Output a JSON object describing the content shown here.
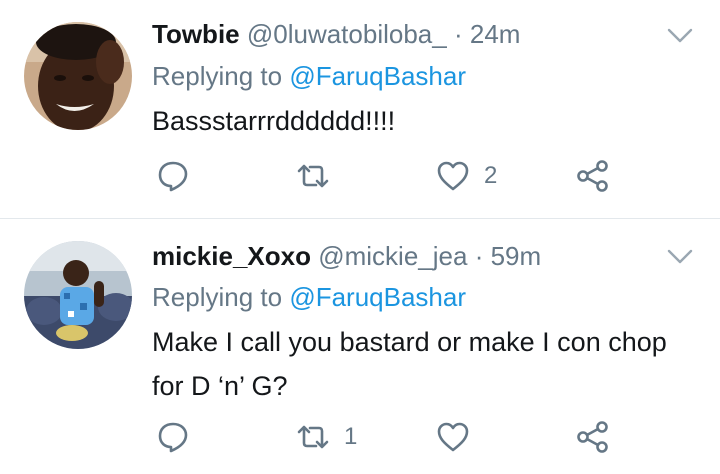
{
  "tweets": [
    {
      "display_name": "Towbie",
      "handle": "@0luwatobiloba_",
      "separator": "·",
      "time": "24m",
      "replying_prefix": "Replying to",
      "replying_to": "@FaruqBashar",
      "text": "Bassstarrrdddddd!!!!",
      "reply_count": "",
      "retweet_count": "",
      "like_count": "2"
    },
    {
      "display_name": "mickie_Xoxo",
      "handle": "@mickie_jea",
      "separator": "·",
      "time": "59m",
      "replying_prefix": "Replying to",
      "replying_to": "@FaruqBashar",
      "text": "Make I call you bastard or make I con chop for D ‘n’ G?",
      "reply_count": "",
      "retweet_count": "1",
      "like_count": ""
    }
  ],
  "colors": {
    "primary_text": "#14171a",
    "secondary_text": "#657786",
    "link": "#1b95e0",
    "divider": "#e3e8ec"
  },
  "icons": [
    "reply-icon",
    "retweet-icon",
    "like-icon",
    "share-icon",
    "chevron-down-icon"
  ]
}
